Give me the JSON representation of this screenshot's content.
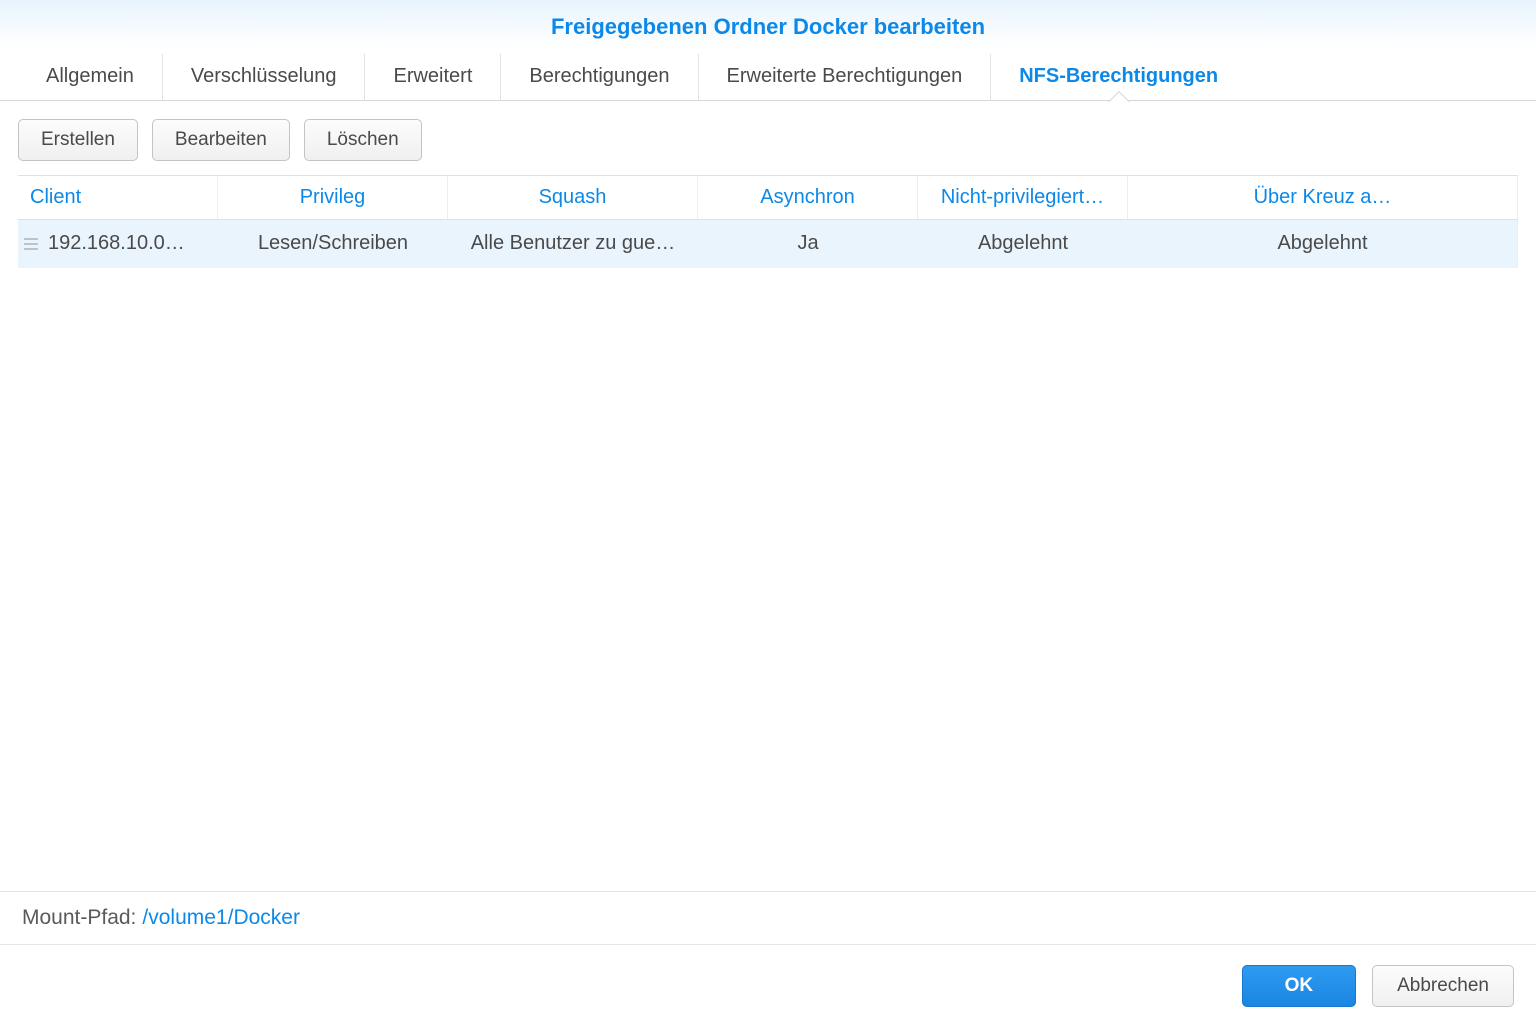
{
  "window": {
    "title": "Freigegebenen Ordner Docker bearbeiten"
  },
  "tabs": [
    {
      "label": "Allgemein"
    },
    {
      "label": "Verschlüsselung"
    },
    {
      "label": "Erweitert"
    },
    {
      "label": "Berechtigungen"
    },
    {
      "label": "Erweiterte Berechtigungen"
    },
    {
      "label": "NFS-Berechtigungen",
      "active": true
    }
  ],
  "toolbar": {
    "create": "Erstellen",
    "edit": "Bearbeiten",
    "delete": "Löschen"
  },
  "table": {
    "headers": {
      "client": "Client",
      "privilege": "Privileg",
      "squash": "Squash",
      "async": "Asynchron",
      "nonpriv": "Nicht-privilegiert…",
      "cross": "Über Kreuz a…"
    },
    "rows": [
      {
        "client": "192.168.10.0…",
        "privilege": "Lesen/Schreiben",
        "squash": "Alle Benutzer zu gue…",
        "async": "Ja",
        "nonpriv": "Abgelehnt",
        "cross": "Abgelehnt"
      }
    ]
  },
  "mount": {
    "label": "Mount-Pfad:",
    "value": "/volume1/Docker"
  },
  "footer": {
    "ok": "OK",
    "cancel": "Abbrechen"
  }
}
